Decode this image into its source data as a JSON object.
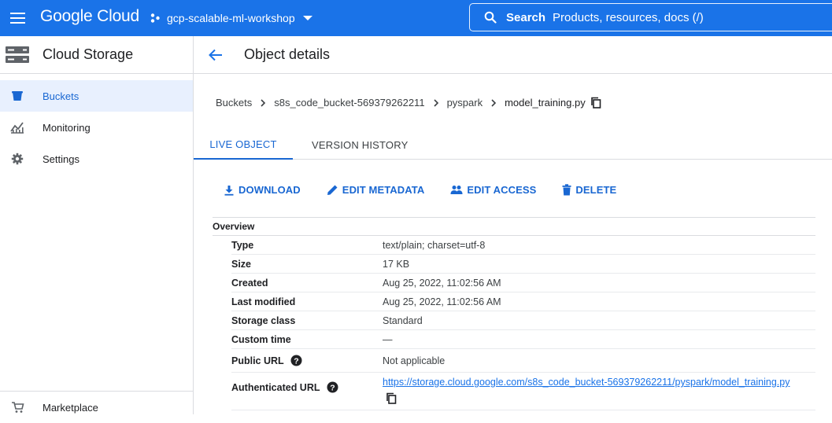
{
  "topbar": {
    "logo": "Google Cloud",
    "project": "gcp-scalable-ml-workshop",
    "search_label": "Search",
    "search_placeholder": "Products, resources, docs (/)"
  },
  "sidebar": {
    "title": "Cloud Storage",
    "items": [
      {
        "label": "Buckets",
        "icon": "bucket-icon"
      },
      {
        "label": "Monitoring",
        "icon": "monitoring-icon"
      },
      {
        "label": "Settings",
        "icon": "gear-icon"
      }
    ],
    "bottom_item": {
      "label": "Marketplace",
      "icon": "cart-icon"
    }
  },
  "main": {
    "title": "Object details",
    "breadcrumbs": [
      "Buckets",
      "s8s_code_bucket-569379262211",
      "pyspark",
      "model_training.py"
    ],
    "tabs": [
      "LIVE OBJECT",
      "VERSION HISTORY"
    ],
    "actions": [
      "DOWNLOAD",
      "EDIT METADATA",
      "EDIT ACCESS",
      "DELETE"
    ],
    "overview_label": "Overview",
    "rows": [
      {
        "key": "Type",
        "value": "text/plain; charset=utf-8"
      },
      {
        "key": "Size",
        "value": "17 KB"
      },
      {
        "key": "Created",
        "value": "Aug 25, 2022, 11:02:56 AM"
      },
      {
        "key": "Last modified",
        "value": "Aug 25, 2022, 11:02:56 AM"
      },
      {
        "key": "Storage class",
        "value": "Standard"
      },
      {
        "key": "Custom time",
        "value": "—"
      },
      {
        "key": "Public URL",
        "value": "Not applicable"
      },
      {
        "key": "Authenticated URL",
        "value": "https://storage.cloud.google.com/s8s_code_bucket-569379262211/pyspark/model_training.py"
      }
    ]
  },
  "colors": {
    "brand": "#1a73e8",
    "accent": "#1967d2",
    "active_bg": "#e8f0fe"
  }
}
